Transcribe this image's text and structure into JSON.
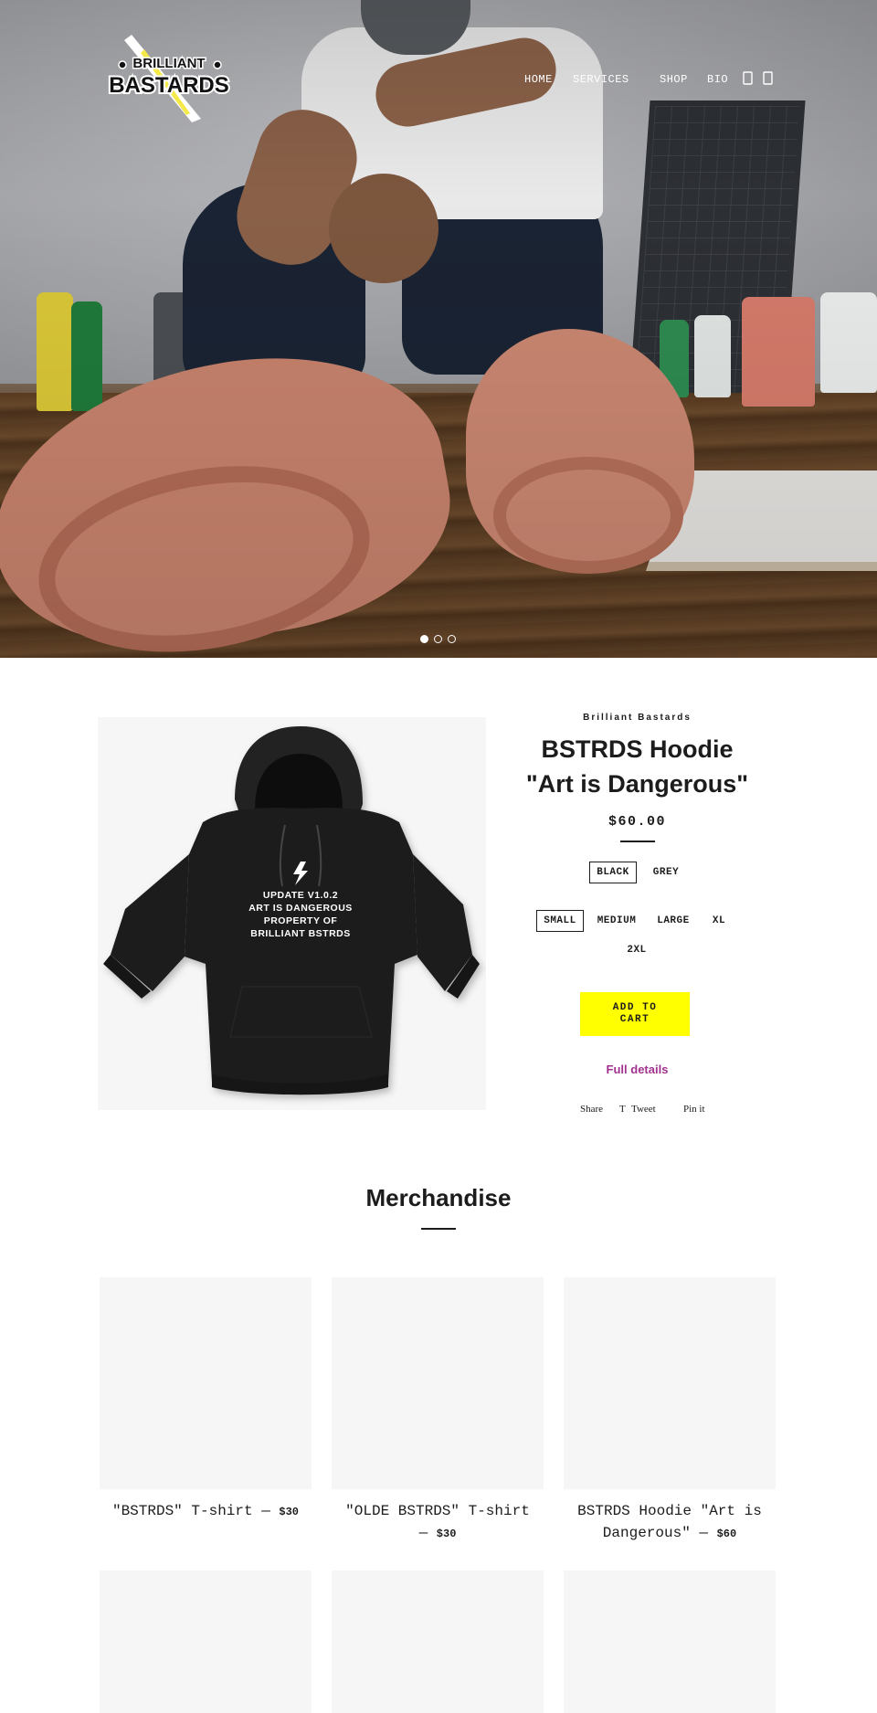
{
  "brand": {
    "logo_top": "BRILLIANT",
    "logo_bottom": "BASTARDS"
  },
  "nav": {
    "items": [
      {
        "label": "HOME"
      },
      {
        "label": "SERVICES"
      },
      {
        "label": "SHOP"
      },
      {
        "label": "BIO"
      }
    ],
    "icons": [
      "user-icon",
      "cart-icon"
    ]
  },
  "slideshow": {
    "slide_count": 3,
    "active_index": 0
  },
  "product": {
    "vendor": "Brilliant Bastards",
    "title_line1": "BSTRDS Hoodie",
    "title_line2": "\"Art is Dangerous\"",
    "price": "$60.00",
    "print_lines": [
      "UPDATE V1.0.2",
      "ART IS DANGEROUS",
      "PROPERTY OF",
      "BRILLIANT BSTRDS"
    ],
    "colors": {
      "options": [
        "BLACK",
        "GREY"
      ],
      "selected": "BLACK"
    },
    "sizes": {
      "options": [
        "SMALL",
        "MEDIUM",
        "LARGE",
        "XL",
        "2XL"
      ],
      "selected": "SMALL"
    },
    "add_to_cart_line1": "ADD TO",
    "add_to_cart_line2": "CART",
    "full_details": "Full details",
    "share": {
      "share": "Share",
      "tweet": "Tweet",
      "pin": "Pin it"
    }
  },
  "merch": {
    "title": "Merchandise",
    "items": [
      {
        "name": "\"BSTRDS\" T-shirt",
        "sep": " — ",
        "price": "$30"
      },
      {
        "name": "\"OLDE BSTRDS\" T-shirt",
        "sep": "— ",
        "price": "$30"
      },
      {
        "name": "BSTRDS Hoodie \"Art is",
        "name2": "Dangerous\"",
        "sep": " — ",
        "price": "$60"
      }
    ]
  },
  "colors": {
    "accent_yellow": "#ffff00",
    "link_purple": "#a3328f",
    "text": "#1c1c1c",
    "placeholder": "#f6f6f6"
  }
}
